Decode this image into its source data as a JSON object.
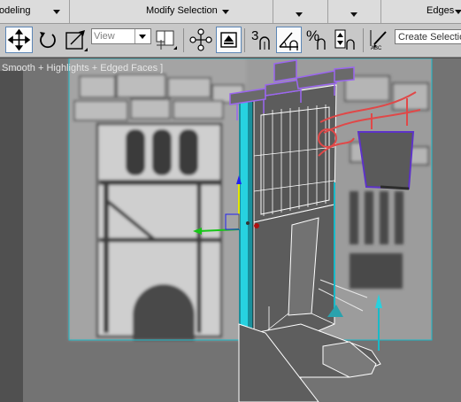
{
  "ribbon": {
    "modeling_label": "odeling",
    "modify_selection_label": "Modify Selection",
    "edges_label": "Edges"
  },
  "toolbar": {
    "coordinate_system": "View",
    "snap_angle_label": "3",
    "snap_percent_label": "%",
    "spell_label": "ABC",
    "selection_set_placeholder": "Create Selection Set"
  },
  "viewport": {
    "label": "Smooth + Highlights + Edged Faces ]"
  },
  "icons": [
    "select-move-icon",
    "select-rotate-icon",
    "select-scale-icon",
    "coordinate-combo-arrow-icon",
    "use-pivot-icon",
    "select-manipulate-icon",
    "keyboard-shortcut-icon",
    "snaps-toggle-icon",
    "angle-snap-icon",
    "percent-snap-icon",
    "spinner-snap-icon",
    "edit-named-selection-icon"
  ],
  "colors": {
    "selection_cyan": "#19b9c8",
    "gizmo_yellow": "#e5e600",
    "gizmo_green": "#17c617",
    "gizmo_blue": "#2222ee",
    "mesh_purple": "#8c56e0",
    "mesh_red": "#e04848"
  }
}
